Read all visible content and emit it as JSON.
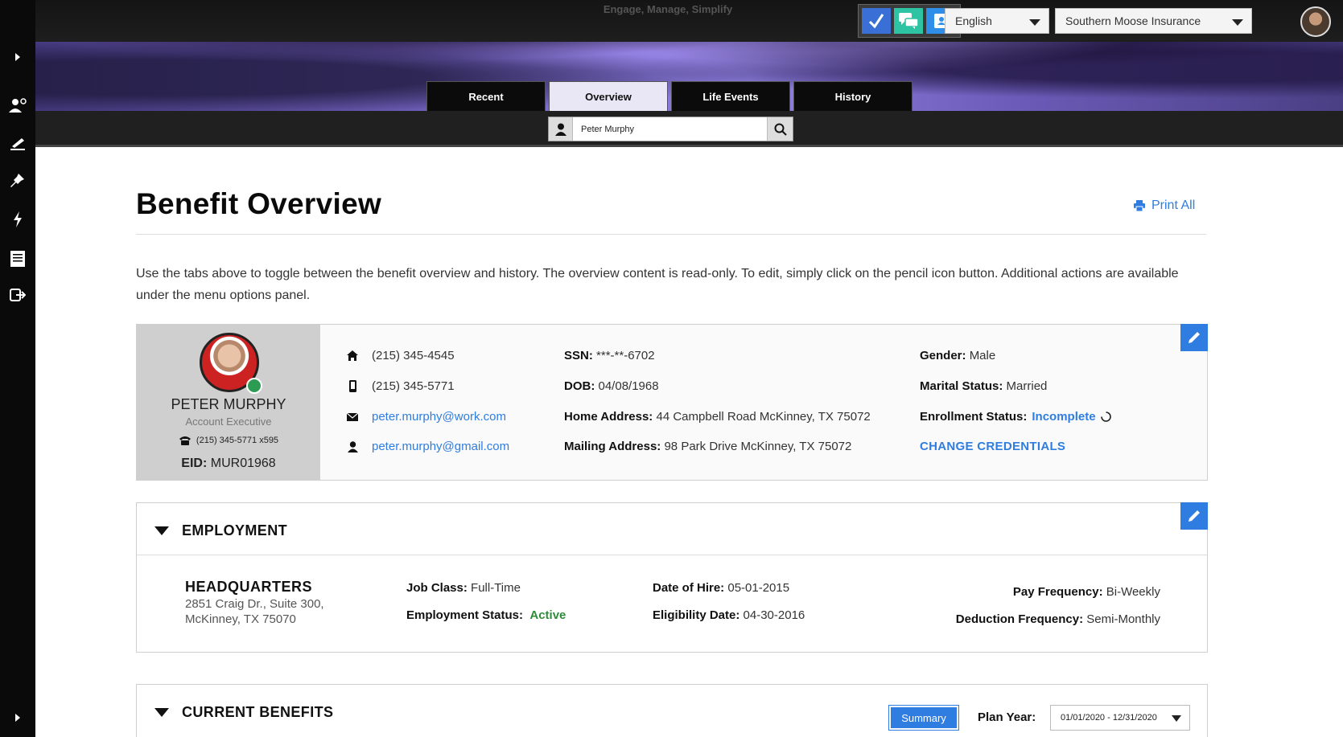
{
  "header": {
    "tagline": "Engage, Manage, Simplify",
    "language": "English",
    "company": "Southern Moose Insurance"
  },
  "tabs": [
    {
      "label": "Recent"
    },
    {
      "label": "Overview"
    },
    {
      "label": "Life Events"
    },
    {
      "label": "History"
    }
  ],
  "search": {
    "value": "Peter Murphy"
  },
  "page": {
    "title": "Benefit Overview",
    "print_label": "Print All",
    "intro": "Use the tabs above to toggle between the benefit overview and history. The overview content is read-only. To edit, simply click on the pencil icon button. Additional actions are available under the menu options panel."
  },
  "profile": {
    "name": "PETER MURPHY",
    "role": "Account Executive",
    "phone_ext": "(215) 345-5771 x595",
    "eid_label": "EID:",
    "eid": "MUR01968",
    "home_phone": "(215) 345-4545",
    "mobile_phone": "(215) 345-5771",
    "work_email": "peter.murphy@work.com",
    "personal_email": "peter.murphy@gmail.com",
    "ssn_label": "SSN:",
    "ssn": "***-**-6702",
    "dob_label": "DOB:",
    "dob": "04/08/1968",
    "home_address_label": "Home Address:",
    "home_address": "44 Campbell Road McKinney, TX 75072",
    "mailing_address_label": "Mailing Address:",
    "mailing_address": "98 Park Drive McKinney, TX 75072",
    "gender_label": "Gender:",
    "gender": "Male",
    "marital_label": "Marital Status:",
    "marital": "Married",
    "enrollment_label": "Enrollment Status:",
    "enrollment": "Incomplete",
    "change_credentials": "CHANGE CREDENTIALS"
  },
  "employment": {
    "heading": "EMPLOYMENT",
    "location": "HEADQUARTERS",
    "address_line1": "2851 Craig Dr., Suite 300,",
    "address_line2": "McKinney, TX 75070",
    "job_class_label": "Job Class:",
    "job_class": "Full-Time",
    "emp_status_label": "Employment Status:",
    "emp_status": "Active",
    "hire_label": "Date of Hire:",
    "hire_date": "05-01-2015",
    "elig_label": "Eligibility Date:",
    "elig_date": "04-30-2016",
    "pay_freq_label": "Pay Frequency:",
    "pay_freq": "Bi-Weekly",
    "ded_freq_label": "Deduction Frequency:",
    "ded_freq": "Semi-Monthly"
  },
  "benefits": {
    "heading": "CURRENT BENEFITS",
    "summary_label": "Summary",
    "plan_year_label": "Plan Year:",
    "plan_year": "01/01/2020 - 12/31/2020"
  },
  "colors": {
    "accent": "#2f7de0",
    "active": "#2e8b3a"
  }
}
